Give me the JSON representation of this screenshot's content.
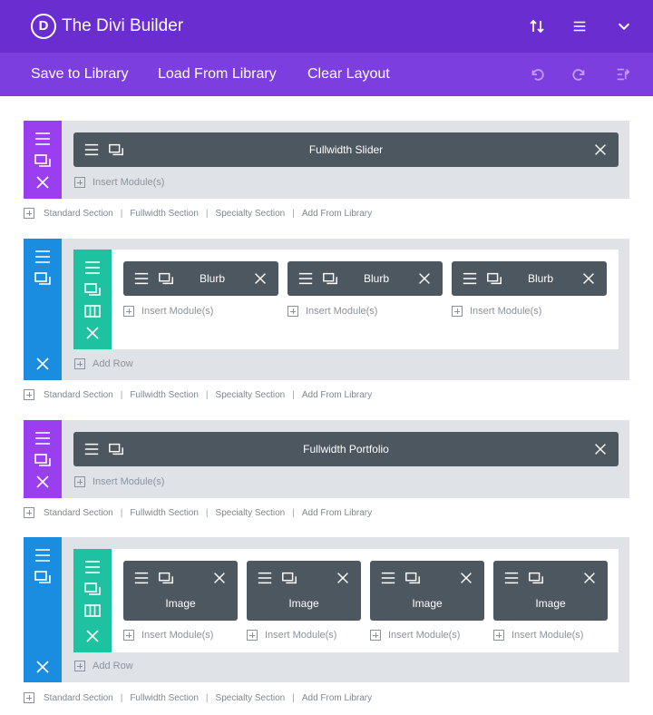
{
  "header": {
    "title": "The Divi Builder",
    "logo_letter": "D"
  },
  "toolbar": {
    "save": "Save to Library",
    "load": "Load From Library",
    "clear": "Clear Layout"
  },
  "common": {
    "insert_modules": "Insert Module(s)",
    "add_row": "Add Row",
    "links": [
      "Standard Section",
      "Fullwidth Section",
      "Specialty Section",
      "Add From Library"
    ],
    "separator": "|"
  },
  "sections": [
    {
      "type": "fullwidth",
      "modules": [
        "Fullwidth Slider"
      ]
    },
    {
      "type": "standard",
      "columns": [
        "Blurb",
        "Blurb",
        "Blurb"
      ]
    },
    {
      "type": "fullwidth",
      "modules": [
        "Fullwidth Portfolio"
      ]
    },
    {
      "type": "standard",
      "columns": [
        "Image",
        "Image",
        "Image",
        "Image"
      ]
    }
  ],
  "colors": {
    "header": "#6a2ed0",
    "toolbar": "#7d3ee0",
    "fullwidth_bar": "#9a3ff0",
    "standard_bar": "#1a8de0",
    "row_bar": "#1fc2a0",
    "module": "#4d5760"
  }
}
